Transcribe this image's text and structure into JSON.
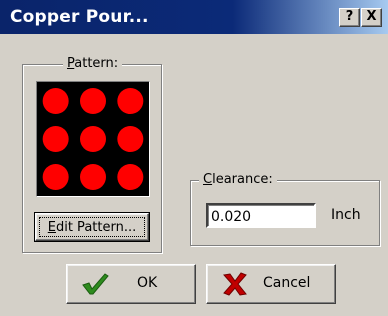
{
  "window": {
    "title": "Copper Pour...",
    "help_button": "?",
    "close_button": "X"
  },
  "pattern_group": {
    "legend_prefix": "",
    "legend_accel": "P",
    "legend_rest": "attern:",
    "dot_color": "#ff0000",
    "background_color": "#000000",
    "rows": 3,
    "columns": 3
  },
  "edit_pattern_button": {
    "accel": "E",
    "rest": "dit Pattern..."
  },
  "clearance_group": {
    "legend_accel": "C",
    "legend_rest": "learance:",
    "value": "0.020",
    "unit": "Inch"
  },
  "ok_button": {
    "label": "OK",
    "icon": "checkmark-icon",
    "icon_color": "#2e8b1e"
  },
  "cancel_button": {
    "label": "Cancel",
    "icon": "x-icon",
    "icon_color": "#c00000"
  }
}
